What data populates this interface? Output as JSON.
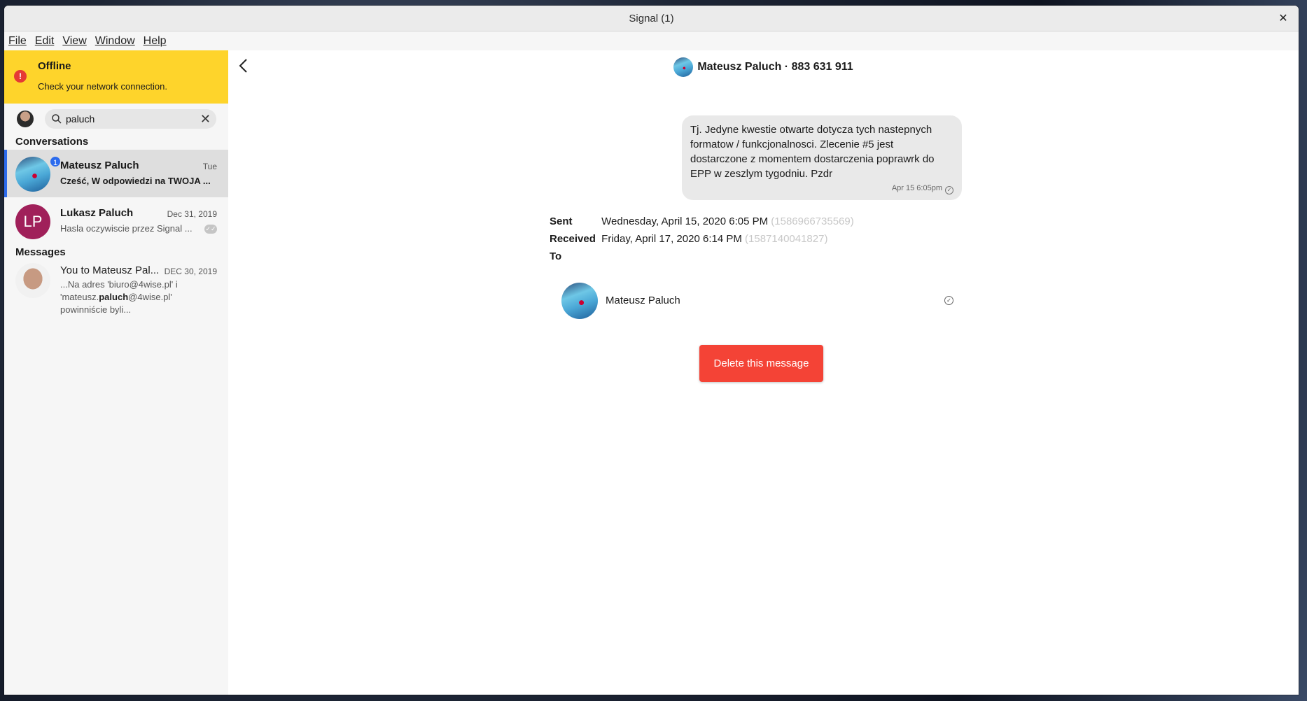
{
  "window": {
    "title": "Signal (1)",
    "close_glyph": "✕"
  },
  "menu": [
    {
      "label": "File"
    },
    {
      "label": "Edit"
    },
    {
      "label": "View"
    },
    {
      "label": "Window"
    },
    {
      "label": "Help"
    }
  ],
  "offline_banner": {
    "title": "Offline",
    "subtitle": "Check your network connection.",
    "icon": "alert-icon",
    "icon_glyph": "!",
    "color": "#fed42b"
  },
  "search": {
    "value": "paluch",
    "clear_glyph": "✕"
  },
  "sidebar": {
    "conversations_heading": "Conversations",
    "messages_heading": "Messages",
    "conversations": [
      {
        "name": "Mateusz Paluch",
        "time": "Tue",
        "preview": "Cześć, W odpowiedzi na TWOJA ...",
        "unread": "1",
        "selected": true
      },
      {
        "name": "Lukasz Paluch",
        "initials": "LP",
        "time": "Dec 31, 2019",
        "preview": "Hasla oczywiscie przez Signal ...",
        "status_icon": "read-check-icon",
        "status_glyph": "✓✓"
      }
    ],
    "messages": [
      {
        "name": "You to Mateusz Pal...",
        "time": "DEC 30, 2019",
        "snippet_pre": "...Na adres 'biuro@4wise.pl' i 'mateusz.",
        "snippet_match": "paluch",
        "snippet_post": "@4wise.pl' powinniście byli..."
      }
    ]
  },
  "conversation_header": {
    "title": "Mateusz Paluch · 883 631 911"
  },
  "message": {
    "text": "Tj. Jedyne kwestie otwarte dotycza tych nastepnych formatow / funkcjonalnosci. Zlecenie #5 jest dostarczone z momentem dostarczenia poprawrk do EPP w zeszlym tygodniu. Pzdr",
    "meta": "Apr 15 6:05pm",
    "status_glyph": "✓"
  },
  "details": {
    "sent_label": "Sent",
    "sent_value": "Wednesday, April 15, 2020 6:05 PM",
    "sent_ts": "(1586966735569)",
    "received_label": "Received",
    "received_value": "Friday, April 17, 2020 6:14 PM",
    "received_ts": "(1587140041827)",
    "to_label": "To"
  },
  "recipient": {
    "name": "Mateusz Paluch",
    "status_glyph": "✓"
  },
  "delete_button": {
    "label": "Delete this message",
    "color": "#f44336"
  },
  "colors": {
    "accent": "#2c6bed",
    "sidebar_bg": "#f6f6f6",
    "bubble_bg": "#e9e9e9"
  }
}
